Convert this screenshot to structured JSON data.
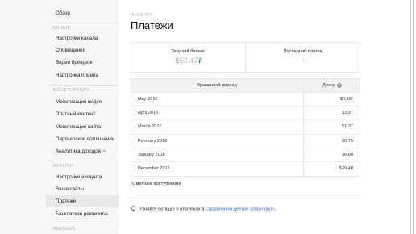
{
  "sidebar": {
    "top_item": "Обзор",
    "sections": [
      {
        "title": "КАНАЛ",
        "items": [
          "Настройки канала",
          "Оповещения",
          "Видео брендинг",
          "Настройка плеера"
        ]
      },
      {
        "title": "МОНЕТИЗАЦИЯ",
        "items": [
          "Монетизация видео",
          "Платный контент",
          "Монетизация сайта",
          "Партнерское соглашение",
          "Аналитика доходов"
        ]
      },
      {
        "title": "АККАУНТ",
        "items": [
          "Настройки аккаунта",
          "Ваши сайты",
          "Платежи",
          "Банковские реквизиты"
        ]
      },
      {
        "title": "РЕКЛАМА",
        "items": []
      }
    ],
    "active_item": "Платежи"
  },
  "main": {
    "breadcrumb": "АККАУНТ",
    "title": "Платежи",
    "balance": {
      "current_label": "Текущий баланс",
      "current_value": "$52.47",
      "last_payment_label": "Последний платёж",
      "last_payment_value": "-"
    },
    "table": {
      "col_period": "Временной период",
      "col_income": "Доход",
      "rows": [
        {
          "period": "May 2016",
          "amount": "$0.18*"
        },
        {
          "period": "April 2016",
          "amount": "$3.97"
        },
        {
          "period": "March 2016",
          "amount": "$1.37"
        },
        {
          "period": "February 2016",
          "amount": "$0.75"
        },
        {
          "period": "January 2016",
          "amount": "$6.80"
        },
        {
          "period": "December 2015",
          "amount": "$39.40"
        }
      ]
    },
    "footnote": "*Сметные поступления",
    "tip": {
      "prefix": "Узнайте больше о платежах в ",
      "link": "Справочном центре Dailymotion",
      "suffix": "."
    }
  },
  "colors": {
    "accent_link": "#2a6dbf",
    "sidebar_bg": "#f7f7f7",
    "active_bg": "#e9e9e9"
  },
  "icons": [
    "info-icon",
    "help-icon",
    "link-chain-icon",
    "lightbulb-icon"
  ]
}
